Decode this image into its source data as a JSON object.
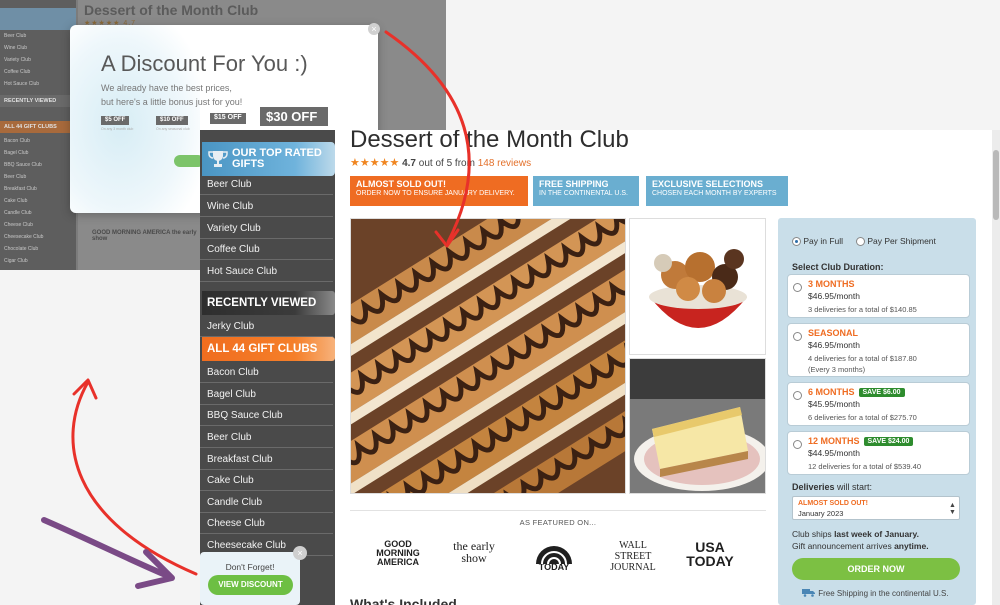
{
  "background_page": {
    "title": "Dessert of the Month Club",
    "rating": "★★★★★ 4.7",
    "side_items": [
      "Beer Club",
      "Wine Club",
      "Variety Club",
      "Coffee Club",
      "Hot Sauce Club"
    ],
    "side_items_2": [
      "Bacon Club",
      "Bagel Club",
      "BBQ Sauce Club",
      "Beer Club",
      "Breakfast Club",
      "Cake Club",
      "Candle Club",
      "Cheese Club",
      "Cheesecake Club",
      "Chocolate Club",
      "Cigar Club"
    ],
    "recently_viewed": "RECENTLY VIEWED",
    "all_clubs": "ALL 44 GIFT CLUBS",
    "logos": "GOOD MORNING AMERICA   the early show"
  },
  "popup": {
    "title": "A Discount For You :)",
    "subtitle_line1": "We already have the best prices,",
    "subtitle_line2": "but here's a little bonus just for you!",
    "coupons": [
      "$5 OFF",
      "$10 OFF",
      "$15 OFF"
    ],
    "coupon_notes": [
      "On any 3 month club",
      "On any seasonal club"
    ],
    "big_coupon": "$30 OFF",
    "close": "×"
  },
  "sidebar": {
    "top_rated": "OUR TOP RATED GIFTS",
    "top_items": [
      "Beer Club",
      "Wine Club",
      "Variety Club",
      "Coffee Club",
      "Hot Sauce Club"
    ],
    "recently_viewed": "RECENTLY VIEWED",
    "recent_items": [
      "Jerky Club"
    ],
    "all_clubs": "ALL 44 GIFT CLUBS",
    "club_items": [
      "Bacon Club",
      "Bagel Club",
      "BBQ Sauce Club",
      "Beer Club",
      "Breakfast Club",
      "Cake Club",
      "Candle Club",
      "Cheese Club",
      "Cheesecake Club"
    ]
  },
  "product": {
    "title": "Dessert of the Month Club",
    "stars": "★★★★★",
    "rating_value": "4.7",
    "rating_text": "out of 5 from",
    "reviews": "148 reviews",
    "badges": [
      {
        "title": "ALMOST SOLD OUT!",
        "sub": "ORDER NOW TO ENSURE JANUARY DELIVERY."
      },
      {
        "title": "FREE SHIPPING",
        "sub": "IN THE CONTINENTAL U.S."
      },
      {
        "title": "EXCLUSIVE SELECTIONS",
        "sub": "CHOSEN EACH MONTH BY EXPERTS"
      }
    ],
    "featured_on": "AS FEATURED ON...",
    "logos": [
      "GOOD MORNING AMERICA",
      "the early show",
      "TODAY",
      "WALL STREET JOURNAL",
      "USA TODAY"
    ],
    "whats_included": "What's Included"
  },
  "purchase": {
    "pay_in_full": "Pay in Full",
    "pay_per_shipment": "Pay Per Shipment",
    "select_duration": "Select Club Duration:",
    "options": [
      {
        "name": "3 MONTHS",
        "price": "$46.95/month",
        "total": "3 deliveries for a total of $140.85",
        "extra": "",
        "save": ""
      },
      {
        "name": "SEASONAL",
        "price": "$46.95/month",
        "total": "4 deliveries for a total of $187.80",
        "extra": "(Every 3 months)",
        "save": ""
      },
      {
        "name": "6 MONTHS",
        "price": "$45.95/month",
        "total": "6 deliveries for a total of $275.70",
        "extra": "",
        "save": "SAVE $6.00"
      },
      {
        "name": "12 MONTHS",
        "price": "$44.95/month",
        "total": "12 deliveries for a total of $539.40",
        "extra": "",
        "save": "SAVE $24.00"
      }
    ],
    "deliveries_start_label": "Deliveries",
    "deliveries_start_label2": "will start:",
    "select_badge": "ALMOST SOLD OUT!",
    "select_value": "January 2023",
    "ships_line1_a": "Club ships",
    "ships_line1_b": "last week of January.",
    "ships_line2_a": "Gift announcement arrives",
    "ships_line2_b": "anytime.",
    "order_now": "ORDER NOW",
    "free_shipping": "Free Shipping in the continental U.S."
  },
  "reminder": {
    "text": "Don't Forget!",
    "button": "VIEW DISCOUNT",
    "close": "×"
  },
  "colors": {
    "accent_orange": "#ef6c22",
    "accent_blue": "#6aaed0",
    "green": "#7cc043",
    "arrow_red": "#e8312a",
    "arrow_purple": "#7a4a86"
  }
}
